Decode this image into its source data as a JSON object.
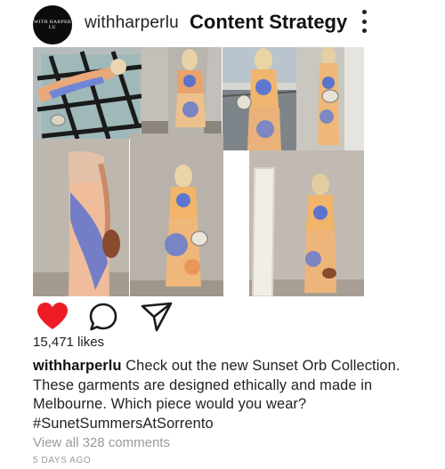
{
  "header": {
    "avatar_text": "WITH HARPER LU",
    "username": "withharperlu",
    "title": "Content Strategy"
  },
  "post": {
    "likes": "15,471 likes",
    "caption_user": "withharperlu",
    "caption_text": "Check out the new Sunset Orb Collection. These garments are designed ethically and made in Melbourne. Which piece would you wear? #SunetSummersAtSorrento",
    "view_comments": "View all 328 comments",
    "age": "5 DAYS AGO",
    "liked": true
  },
  "icons": {
    "like": "heart-icon",
    "comment": "comment-bubble-icon",
    "share": "paper-plane-icon",
    "more": "more-vertical-icon"
  },
  "colors": {
    "like_red": "#ed1c24",
    "text": "#222222",
    "muted": "#9a9a9a",
    "avatar_bg": "#0c0c0c"
  }
}
